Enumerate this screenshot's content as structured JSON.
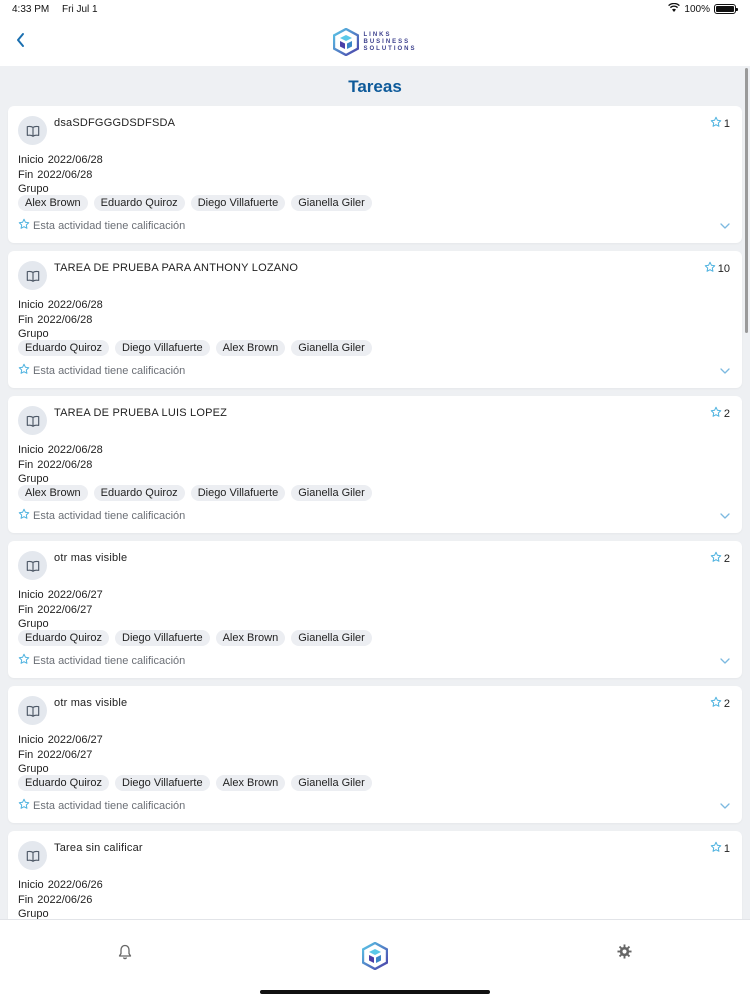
{
  "status_bar": {
    "time": "4:33 PM",
    "date": "Fri Jul 1",
    "battery": "100%"
  },
  "header": {
    "logo_lines": [
      "LINKS",
      "BUSINESS",
      "SOLUTIONS"
    ]
  },
  "page": {
    "title": "Tareas"
  },
  "labels": {
    "start": "Inicio",
    "end": "Fin",
    "group": "Grupo",
    "rating_note": "Esta actividad tiene calificación"
  },
  "tasks": [
    {
      "title": "dsaSDFGGGDSDFSDA",
      "score": "1",
      "start": "2022/06/28",
      "end": "2022/06/28",
      "members": [
        "Alex Brown",
        "Eduardo Quiroz",
        "Diego Villafuerte",
        "Gianella Giler"
      ]
    },
    {
      "title": "TAREA DE PRUEBA PARA ANTHONY LOZANO",
      "score": "10",
      "start": "2022/06/28",
      "end": "2022/06/28",
      "members": [
        "Eduardo Quiroz",
        "Diego Villafuerte",
        "Alex Brown",
        "Gianella Giler"
      ]
    },
    {
      "title": "TAREA DE PRUEBA LUIS LOPEZ",
      "score": "2",
      "start": "2022/06/28",
      "end": "2022/06/28",
      "members": [
        "Alex Brown",
        "Eduardo Quiroz",
        "Diego Villafuerte",
        "Gianella Giler"
      ]
    },
    {
      "title": "otr mas visible",
      "score": "2",
      "start": "2022/06/27",
      "end": "2022/06/27",
      "members": [
        "Eduardo Quiroz",
        "Diego Villafuerte",
        "Alex Brown",
        "Gianella Giler"
      ]
    },
    {
      "title": "otr mas visible",
      "score": "2",
      "start": "2022/06/27",
      "end": "2022/06/27",
      "members": [
        "Eduardo Quiroz",
        "Diego Villafuerte",
        "Alex Brown",
        "Gianella Giler"
      ]
    },
    {
      "title": "Tarea sin calificar",
      "score": "1",
      "start": "2022/06/26",
      "end": "2022/06/26",
      "members": []
    }
  ],
  "colors": {
    "accent": "#0d5a9a",
    "star": "#4fb3e0",
    "background": "#eef0f3"
  },
  "icons": {
    "back": "chevron-left-icon",
    "task": "book-icon",
    "score": "star-icon",
    "expand": "chevron-down-icon",
    "tab_notifications": "bell-icon",
    "tab_home": "logo-icon",
    "tab_settings": "gear-icon"
  }
}
